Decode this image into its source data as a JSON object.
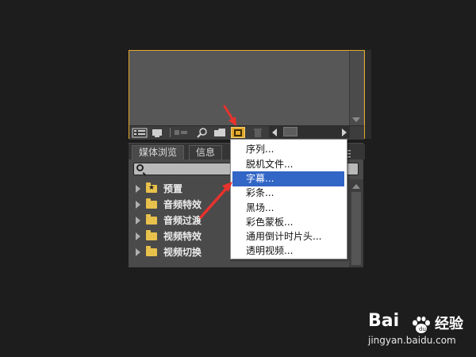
{
  "panel_tabs": [
    "媒体浏览",
    "信息"
  ],
  "effects_tree": [
    {
      "label": "预置",
      "icon": "preset-folder-icon"
    },
    {
      "label": "音频特效",
      "icon": "folder-icon"
    },
    {
      "label": "音频过渡",
      "icon": "folder-icon"
    },
    {
      "label": "视频特效",
      "icon": "folder-icon"
    },
    {
      "label": "视频切换",
      "icon": "folder-icon"
    }
  ],
  "context_menu": {
    "items": [
      "序列...",
      "脱机文件...",
      "字幕...",
      "彩条...",
      "黑场...",
      "彩色蒙板...",
      "通用倒计时片头...",
      "透明视频..."
    ],
    "highlighted_index": 2
  },
  "watermark": {
    "brand_left": "Bai",
    "brand_right": "经验",
    "url": "jingyan.baidu.com"
  },
  "colors": {
    "menu_highlight": "#3165c6",
    "panel_border": "#e3a92c",
    "arrow": "#e8322d",
    "folder": "#e8c14c"
  }
}
